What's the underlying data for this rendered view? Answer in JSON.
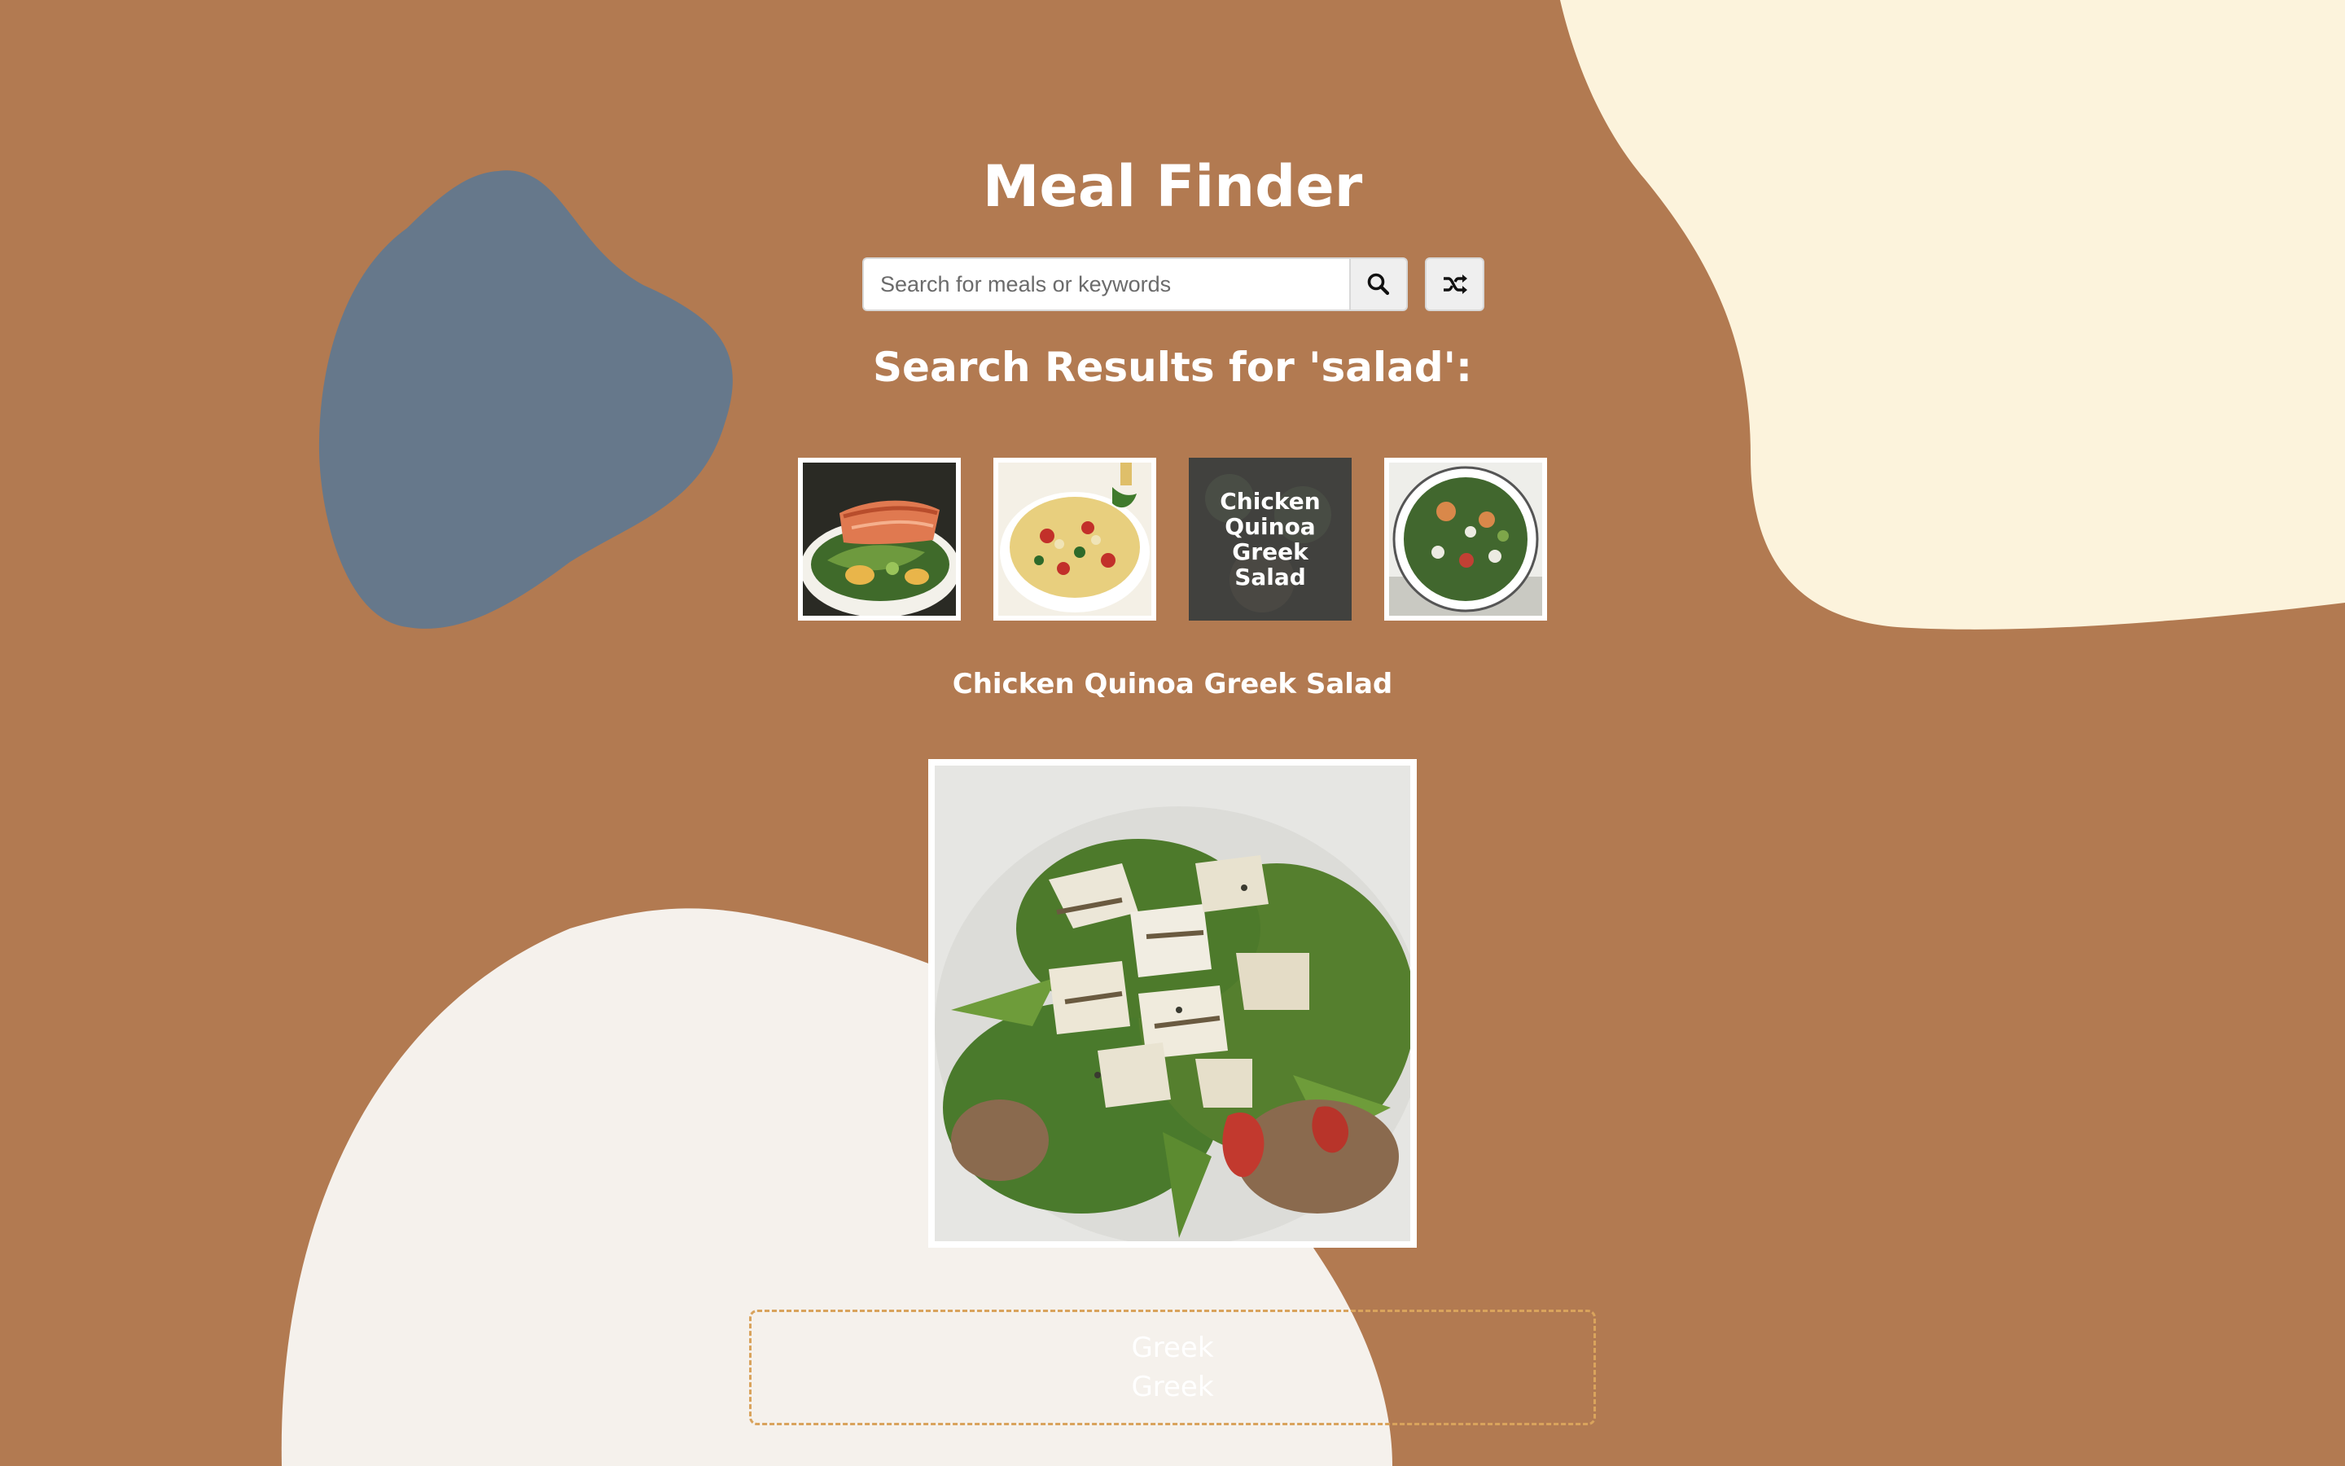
{
  "app": {
    "title": "Meal Finder"
  },
  "search": {
    "placeholder": "Search for meals or keywords",
    "value": "",
    "search_icon": "search-icon",
    "random_icon": "shuffle-icon"
  },
  "results": {
    "heading": "Search Results for 'salad':",
    "meals": [
      {
        "name": "",
        "thumbnail": "salmon-salad"
      },
      {
        "name": "",
        "thumbnail": "pasta-salad"
      },
      {
        "name": "Chicken Quinoa Greek Salad",
        "thumbnail": "chicken-quinoa-greek-salad",
        "hovered": true
      },
      {
        "name": "",
        "thumbnail": "green-salad-bowl"
      }
    ]
  },
  "selected_meal": {
    "name": "Chicken Quinoa Greek Salad",
    "image": "chicken-quinoa-greek-salad",
    "tags": [
      "Greek",
      "Greek"
    ]
  },
  "colors": {
    "background": "#b27a51",
    "blob_blue": "#66788b",
    "blob_cream": "#fcf3dc",
    "blob_white": "#f5f1ec",
    "tag_border": "#d9a35c"
  }
}
